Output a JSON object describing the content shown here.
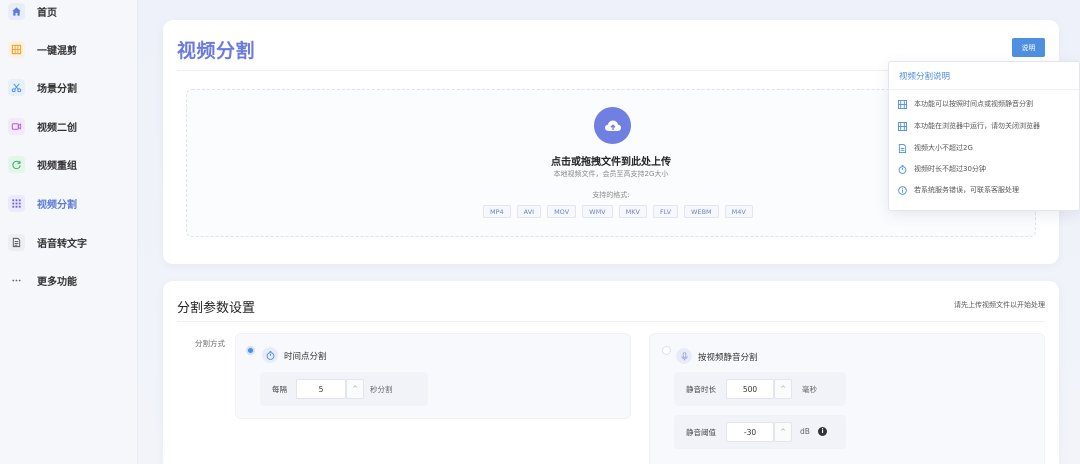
{
  "sidebar": {
    "items": [
      {
        "label": "首页",
        "icon": "home-icon",
        "color": "#5a7bd8"
      },
      {
        "label": "一键混剪",
        "icon": "grid-icon",
        "color": "#f0a030"
      },
      {
        "label": "场景分割",
        "icon": "scissors-icon",
        "color": "#4f8fe0"
      },
      {
        "label": "视频二创",
        "icon": "video-camera-icon",
        "color": "#b35fd8"
      },
      {
        "label": "视频重组",
        "icon": "refresh-icon",
        "color": "#3fb56a"
      },
      {
        "label": "视频分割",
        "icon": "split-grid-icon",
        "color": "#6c5fd8"
      },
      {
        "label": "语音转文字",
        "icon": "document-icon",
        "color": "#555555"
      },
      {
        "label": "更多功能",
        "icon": "more-icon",
        "color": "#555555"
      }
    ],
    "active_index": 5
  },
  "header": {
    "title": "视频分割",
    "help_button": "说明"
  },
  "upload": {
    "title": "点击或拖拽文件到此处上传",
    "subtitle": "本地视频文件，会员至高支持2G大小",
    "formats_label": "支持的格式:",
    "formats": [
      "MP4",
      "AVI",
      "MOV",
      "WMV",
      "MKV",
      "FLV",
      "WEBM",
      "M4V"
    ]
  },
  "help_popover": {
    "title": "视频分割说明",
    "items": [
      {
        "icon": "film-icon",
        "text": "本功能可以按照时间点或视频静音分割"
      },
      {
        "icon": "film-icon",
        "text": "本功能在浏览器中运行，请勿关闭浏览器"
      },
      {
        "icon": "file-icon",
        "text": "视频大小不超过2G"
      },
      {
        "icon": "timer-icon",
        "text": "视频时长不超过30分钟"
      },
      {
        "icon": "info-circle-icon",
        "text": "若系统服务错误，可联系客服处理"
      }
    ]
  },
  "settings": {
    "title": "分割参数设置",
    "hint": "请先上传视频文件以开始处理",
    "mode_label": "分割方式",
    "time_option": {
      "label": "时间点分割",
      "selected": true,
      "every_label": "每隔",
      "every_value": "5",
      "unit": "秒分割"
    },
    "silence_option": {
      "label": "按视频静音分割",
      "selected": false,
      "duration_label": "静音时长",
      "duration_value": "500",
      "duration_unit": "毫秒",
      "threshold_label": "静音阈值",
      "threshold_value": "-30",
      "threshold_unit": "dB"
    }
  },
  "colors": {
    "accent": "#6a7bdc",
    "primary_button": "#4f8fe0"
  }
}
